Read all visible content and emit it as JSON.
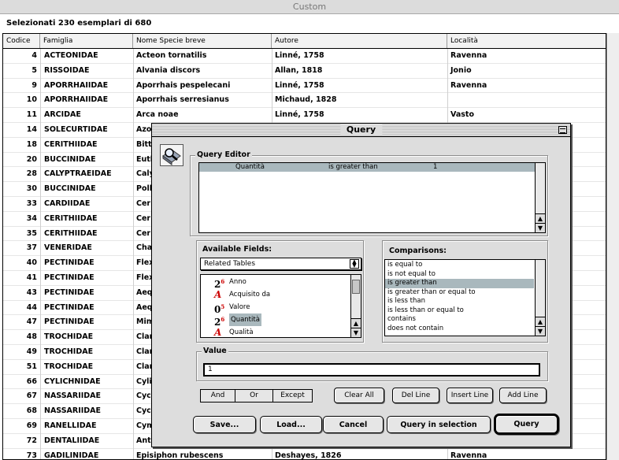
{
  "window": {
    "title": "Custom"
  },
  "selection_info": "Selezionati 230 esemplari di 680",
  "table": {
    "columns": [
      "Codice",
      "Famiglia",
      "Nome Specie breve",
      "Autore",
      "Località"
    ],
    "rows": [
      [
        "4",
        "ACTEONIDAE",
        "Acteon tornatilis",
        "Linné, 1758",
        "Ravenna"
      ],
      [
        "5",
        "RISSOIDAE",
        "Alvania discors",
        "Allan, 1818",
        "Jonio"
      ],
      [
        "9",
        "APORRHAIIDAE",
        "Aporrhais pespelecani",
        "Linné, 1758",
        "Ravenna"
      ],
      [
        "10",
        "APORRHAIIDAE",
        "Aporrhais serresianus",
        "Michaud, 1828",
        ""
      ],
      [
        "11",
        "ARCIDAE",
        "Arca noae",
        "Linné, 1758",
        "Vasto"
      ],
      [
        "14",
        "SOLECURTIDAE",
        "Azo",
        "",
        ""
      ],
      [
        "18",
        "CERITHIIDAE",
        "Bitt",
        "",
        ""
      ],
      [
        "20",
        "BUCCINIDAE",
        "Euth",
        "",
        ""
      ],
      [
        "28",
        "CALYPTRAEIDAE",
        "Caly",
        "",
        ""
      ],
      [
        "30",
        "BUCCINIDAE",
        "Poll",
        "",
        ""
      ],
      [
        "33",
        "CARDIIDAE",
        "Cer",
        "",
        ""
      ],
      [
        "34",
        "CERITHIIDAE",
        "Cer",
        "",
        ""
      ],
      [
        "35",
        "CERITHIIDAE",
        "Cer",
        "",
        ""
      ],
      [
        "37",
        "VENERIDAE",
        "Cha",
        "",
        ""
      ],
      [
        "40",
        "PECTINIDAE",
        "Flex",
        "",
        ""
      ],
      [
        "41",
        "PECTINIDAE",
        "Flex",
        "",
        ""
      ],
      [
        "43",
        "PECTINIDAE",
        "Aeq",
        "",
        ""
      ],
      [
        "44",
        "PECTINIDAE",
        "Aeq",
        "",
        ""
      ],
      [
        "47",
        "PECTINIDAE",
        "Mim",
        "",
        ""
      ],
      [
        "48",
        "TROCHIDAE",
        "Clar",
        "",
        ""
      ],
      [
        "49",
        "TROCHIDAE",
        "Clar",
        "",
        ""
      ],
      [
        "51",
        "TROCHIDAE",
        "Clar",
        "",
        ""
      ],
      [
        "66",
        "CYLICHNIDAE",
        "Cylic",
        "",
        ""
      ],
      [
        "67",
        "NASSARIIDAE",
        "Cyc",
        "",
        ""
      ],
      [
        "68",
        "NASSARIIDAE",
        "Cyc",
        "",
        ""
      ],
      [
        "69",
        "RANELLIDAE",
        "Cym",
        "",
        ""
      ],
      [
        "72",
        "DENTALIIDAE",
        "Ant",
        "",
        ""
      ],
      [
        "73",
        "GADILINIDAE",
        "Episiphon rubescens",
        "Deshayes, 1826",
        "Ravenna"
      ]
    ]
  },
  "dialog": {
    "title": "Query",
    "query_editor": {
      "label": "Query Editor",
      "line": {
        "field": "Quantità",
        "op": "is greater than",
        "value": "1"
      }
    },
    "available_fields": {
      "label": "Available Fields:",
      "popup": "Related Tables",
      "items": [
        {
          "icon": "2⁶",
          "label": "Anno",
          "selected": false
        },
        {
          "icon": "A",
          "label": "Acquisito da",
          "selected": false
        },
        {
          "icon": "0⁵",
          "label": "Valore",
          "selected": false
        },
        {
          "icon": "2⁶",
          "label": "Quantità",
          "selected": true
        },
        {
          "icon": "A",
          "label": "Qualità",
          "selected": false
        }
      ]
    },
    "comparisons": {
      "label": "Comparisons:",
      "items": [
        "is equal to",
        "is not equal to",
        "is greater than",
        "is greater than or equal to",
        "is less than",
        "is less than or equal to",
        "contains",
        "does not contain"
      ],
      "selected_index": 2
    },
    "value": {
      "label": "Value",
      "current": "1"
    },
    "logic_buttons": {
      "and": "And",
      "or": "Or",
      "except": "Except"
    },
    "edit_buttons": {
      "clear_all": "Clear All",
      "del_line": "Del Line",
      "insert_line": "Insert Line",
      "add_line": "Add Line"
    },
    "bottom_buttons": {
      "save": "Save...",
      "load": "Load...",
      "cancel": "Cancel",
      "query_in_selection": "Query in selection",
      "query": "Query"
    }
  }
}
